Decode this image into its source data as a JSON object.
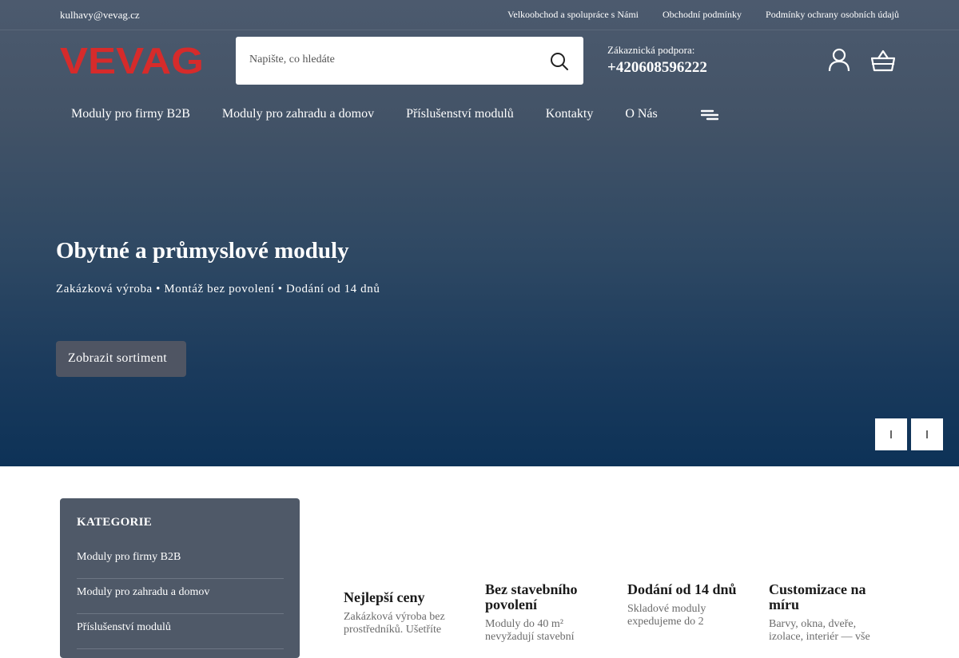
{
  "topbar": {
    "email": "kulhavy@vevag.cz",
    "links": [
      "Velkoobchod a spolupráce s Námi",
      "Obchodní podmínky",
      "Podmínky ochrany osobních údajů"
    ]
  },
  "logo": {
    "text": "VEVAG",
    "color": "#d62b2b"
  },
  "search": {
    "placeholder": "Napište, co hledáte",
    "icon": "search-icon"
  },
  "support": {
    "label": "Zákaznická podpora:",
    "phone": "+420608596222"
  },
  "nav": {
    "items": [
      "Moduly pro firmy B2B",
      "Moduly pro zahradu a domov",
      "Příslušenství modulů",
      "Kontakty",
      "O Nás"
    ],
    "menu_icon": "menu-lines-icon"
  },
  "hero": {
    "title": "Obytné a průmyslové moduly",
    "subtitle": "Zakázková výroba • Montáž bez povolení • Dodání od 14 dnů",
    "button": "Zobrazit sortiment"
  },
  "categories": {
    "heading": "KATEGORIE",
    "items": [
      "Moduly pro firmy B2B",
      "Moduly pro zahradu a domov",
      "Příslušenství modulů"
    ]
  },
  "features": [
    {
      "title": "Nejlepší ceny",
      "text": "Zakázková výroba bez prostředníků. Ušetříte"
    },
    {
      "title": "Bez stavebního povolení",
      "text": "Moduly do 40 m² nevyžadují stavební"
    },
    {
      "title": "Dodání od 14 dnů",
      "text": "Skladové moduly expedujeme do 2"
    },
    {
      "title": "Customizace na míru",
      "text": "Barvy, okna, dveře, izolace, interiér — vše"
    }
  ],
  "colors": {
    "brand_red": "#d62b2b",
    "hero_top": "#4c5a6e",
    "hero_bottom": "#0d3257",
    "panel": "#4f5968"
  }
}
